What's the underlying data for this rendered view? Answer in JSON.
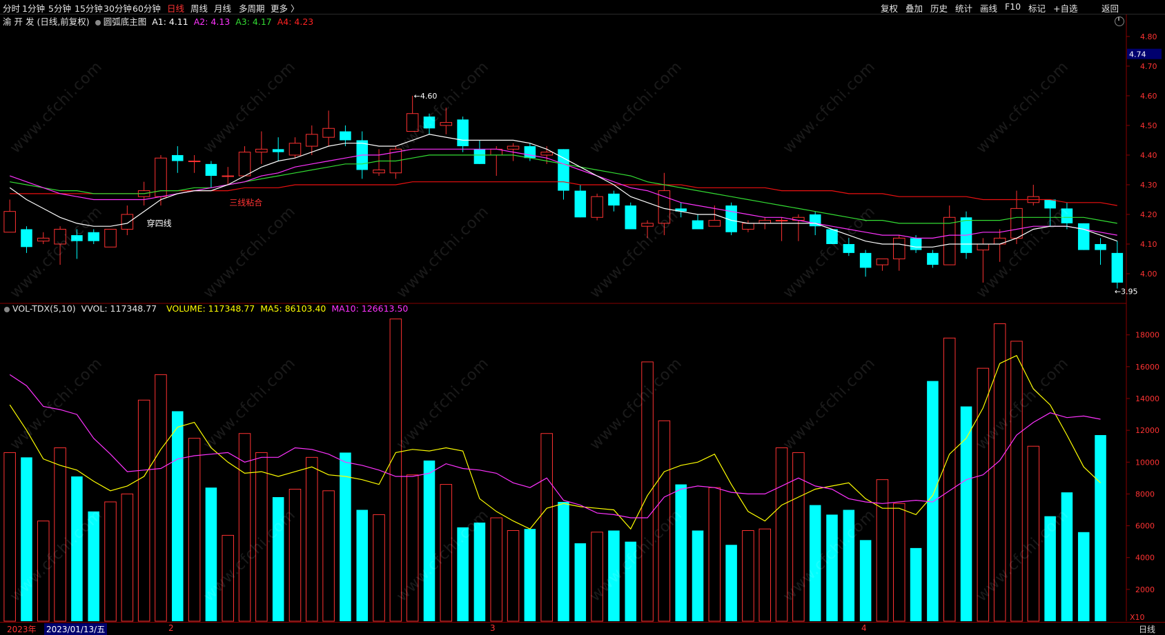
{
  "toolbar": {
    "periods": [
      {
        "label": "分时",
        "active": false
      },
      {
        "label": "1分钟",
        "active": false
      },
      {
        "label": "5分钟",
        "active": false
      },
      {
        "label": "15分钟",
        "active": false
      },
      {
        "label": "30分钟",
        "active": false
      },
      {
        "label": "60分钟",
        "active": false
      },
      {
        "label": "日线",
        "active": true
      },
      {
        "label": "周线",
        "active": false
      },
      {
        "label": "月线",
        "active": false
      },
      {
        "label": "多周期",
        "active": false
      },
      {
        "label": "更多 〉",
        "active": false
      }
    ],
    "right_buttons": [
      "复权",
      "叠加",
      "历史",
      "统计",
      "画线",
      "F10",
      "标记",
      "+自选",
      "返回"
    ]
  },
  "main_header": {
    "stock": "渝 开 发",
    "mode": "(日线,前复权)",
    "indicator": "圆弧底主图",
    "a1": "A1: 4.11",
    "a2": "A2: 4.13",
    "a3": "A3: 4.17",
    "a4": "A4: 4.23",
    "a1_color": "#ffffff",
    "a2_color": "#ff33ff",
    "a3_color": "#33dd33",
    "a4_color": "#ff2222"
  },
  "vol_header": {
    "name": "VOL-TDX(5,10)",
    "vvol": "VVOL: 117348.77",
    "volume": "VOLUME: 117348.77",
    "ma5": "MA5: 86103.40",
    "ma10": "MA10: 126613.50",
    "volume_color": "#ffff00",
    "ma10_color": "#ff33ff"
  },
  "price_axis": {
    "ticks": [
      "4.80",
      "4.70",
      "4.60",
      "4.50",
      "4.40",
      "4.30",
      "4.20",
      "4.10",
      "4.00"
    ],
    "current_price": "4.74"
  },
  "volume_axis": {
    "ticks": [
      "18000",
      "16000",
      "14000",
      "12000",
      "10000",
      "8000",
      "6000",
      "4000",
      "2000"
    ],
    "multiplier": "X10"
  },
  "annotations": {
    "high": "4.60",
    "low": "3.95",
    "label1": "穿四线",
    "label2": "三线粘合"
  },
  "bottom_bar": {
    "year": "2023年",
    "date": "2023/01/13/五",
    "month_labels": [
      "2",
      "3",
      "4"
    ],
    "period": "日线"
  },
  "watermark": "www.cfchi.com",
  "colors": {
    "up": "#ff3232",
    "down": "#00ffff",
    "line_white": "#ffffff",
    "line_magenta": "#ff33ff",
    "line_green": "#33dd33",
    "line_red": "#ee1111",
    "vol_ma5": "#ffff00",
    "vol_ma10": "#ff33ff",
    "axis": "#8a0000"
  },
  "chart_data": {
    "type": "candlestick",
    "candles": [
      {
        "o": 4.14,
        "h": 4.25,
        "l": 4.14,
        "c": 4.21
      },
      {
        "o": 4.15,
        "h": 4.16,
        "l": 4.07,
        "c": 4.09
      },
      {
        "o": 4.11,
        "h": 4.14,
        "l": 4.1,
        "c": 4.12
      },
      {
        "o": 4.1,
        "h": 4.16,
        "l": 4.03,
        "c": 4.15
      },
      {
        "o": 4.13,
        "h": 4.15,
        "l": 4.05,
        "c": 4.11
      },
      {
        "o": 4.14,
        "h": 4.15,
        "l": 4.1,
        "c": 4.11
      },
      {
        "o": 4.09,
        "h": 4.15,
        "l": 4.09,
        "c": 4.15
      },
      {
        "o": 4.15,
        "h": 4.23,
        "l": 4.13,
        "c": 4.2
      },
      {
        "o": 4.26,
        "h": 4.31,
        "l": 4.23,
        "c": 4.28
      },
      {
        "o": 4.26,
        "h": 4.4,
        "l": 4.23,
        "c": 4.39
      },
      {
        "o": 4.4,
        "h": 4.43,
        "l": 4.34,
        "c": 4.38
      },
      {
        "o": 4.38,
        "h": 4.4,
        "l": 4.34,
        "c": 4.38
      },
      {
        "o": 4.37,
        "h": 4.38,
        "l": 4.29,
        "c": 4.33
      },
      {
        "o": 4.33,
        "h": 4.36,
        "l": 4.3,
        "c": 4.33
      },
      {
        "o": 4.33,
        "h": 4.43,
        "l": 4.33,
        "c": 4.41
      },
      {
        "o": 4.41,
        "h": 4.48,
        "l": 4.37,
        "c": 4.42
      },
      {
        "o": 4.42,
        "h": 4.46,
        "l": 4.38,
        "c": 4.41
      },
      {
        "o": 4.4,
        "h": 4.46,
        "l": 4.39,
        "c": 4.44
      },
      {
        "o": 4.43,
        "h": 4.5,
        "l": 4.4,
        "c": 4.47
      },
      {
        "o": 4.46,
        "h": 4.55,
        "l": 4.43,
        "c": 4.49
      },
      {
        "o": 4.48,
        "h": 4.5,
        "l": 4.43,
        "c": 4.45
      },
      {
        "o": 4.45,
        "h": 4.48,
        "l": 4.32,
        "c": 4.35
      },
      {
        "o": 4.34,
        "h": 4.42,
        "l": 4.33,
        "c": 4.35
      },
      {
        "o": 4.34,
        "h": 4.43,
        "l": 4.32,
        "c": 4.42
      },
      {
        "o": 4.48,
        "h": 4.6,
        "l": 4.48,
        "c": 4.54
      },
      {
        "o": 4.53,
        "h": 4.54,
        "l": 4.47,
        "c": 4.49
      },
      {
        "o": 4.5,
        "h": 4.56,
        "l": 4.47,
        "c": 4.51
      },
      {
        "o": 4.52,
        "h": 4.53,
        "l": 4.41,
        "c": 4.43
      },
      {
        "o": 4.42,
        "h": 4.45,
        "l": 4.37,
        "c": 4.37
      },
      {
        "o": 4.4,
        "h": 4.43,
        "l": 4.33,
        "c": 4.42
      },
      {
        "o": 4.42,
        "h": 4.44,
        "l": 4.38,
        "c": 4.43
      },
      {
        "o": 4.43,
        "h": 4.44,
        "l": 4.38,
        "c": 4.39
      },
      {
        "o": 4.4,
        "h": 4.43,
        "l": 4.37,
        "c": 4.41
      },
      {
        "o": 4.42,
        "h": 4.42,
        "l": 4.25,
        "c": 4.28
      },
      {
        "o": 4.28,
        "h": 4.3,
        "l": 4.19,
        "c": 4.19
      },
      {
        "o": 4.19,
        "h": 4.27,
        "l": 4.18,
        "c": 4.26
      },
      {
        "o": 4.27,
        "h": 4.28,
        "l": 4.21,
        "c": 4.23
      },
      {
        "o": 4.23,
        "h": 4.24,
        "l": 4.15,
        "c": 4.15
      },
      {
        "o": 4.16,
        "h": 4.18,
        "l": 4.12,
        "c": 4.17
      },
      {
        "o": 4.17,
        "h": 4.34,
        "l": 4.13,
        "c": 4.28
      },
      {
        "o": 4.22,
        "h": 4.24,
        "l": 4.19,
        "c": 4.21
      },
      {
        "o": 4.18,
        "h": 4.2,
        "l": 4.15,
        "c": 4.15
      },
      {
        "o": 4.16,
        "h": 4.23,
        "l": 4.16,
        "c": 4.18
      },
      {
        "o": 4.23,
        "h": 4.24,
        "l": 4.13,
        "c": 4.14
      },
      {
        "o": 4.15,
        "h": 4.18,
        "l": 4.14,
        "c": 4.17
      },
      {
        "o": 4.17,
        "h": 4.19,
        "l": 4.15,
        "c": 4.18
      },
      {
        "o": 4.18,
        "h": 4.19,
        "l": 4.11,
        "c": 4.18
      },
      {
        "o": 4.18,
        "h": 4.2,
        "l": 4.11,
        "c": 4.19
      },
      {
        "o": 4.2,
        "h": 4.21,
        "l": 4.13,
        "c": 4.16
      },
      {
        "o": 4.15,
        "h": 4.15,
        "l": 4.1,
        "c": 4.1
      },
      {
        "o": 4.1,
        "h": 4.12,
        "l": 4.06,
        "c": 4.07
      },
      {
        "o": 4.07,
        "h": 4.08,
        "l": 3.99,
        "c": 4.02
      },
      {
        "o": 4.03,
        "h": 4.05,
        "l": 4.01,
        "c": 4.05
      },
      {
        "o": 4.05,
        "h": 4.13,
        "l": 4.01,
        "c": 4.12
      },
      {
        "o": 4.12,
        "h": 4.13,
        "l": 4.07,
        "c": 4.08
      },
      {
        "o": 4.07,
        "h": 4.08,
        "l": 4.02,
        "c": 4.03
      },
      {
        "o": 4.03,
        "h": 4.23,
        "l": 4.03,
        "c": 4.19
      },
      {
        "o": 4.19,
        "h": 4.21,
        "l": 4.05,
        "c": 4.07
      },
      {
        "o": 4.08,
        "h": 4.12,
        "l": 3.97,
        "c": 4.1
      },
      {
        "o": 4.1,
        "h": 4.15,
        "l": 4.04,
        "c": 4.12
      },
      {
        "o": 4.12,
        "h": 4.28,
        "l": 4.1,
        "c": 4.22
      },
      {
        "o": 4.24,
        "h": 4.3,
        "l": 4.23,
        "c": 4.26
      },
      {
        "o": 4.25,
        "h": 4.25,
        "l": 4.16,
        "c": 4.22
      },
      {
        "o": 4.22,
        "h": 4.24,
        "l": 4.15,
        "c": 4.17
      },
      {
        "o": 4.17,
        "h": 4.17,
        "l": 4.08,
        "c": 4.08
      },
      {
        "o": 4.1,
        "h": 4.12,
        "l": 4.03,
        "c": 4.08
      },
      {
        "o": 4.07,
        "h": 4.11,
        "l": 3.95,
        "c": 3.97
      }
    ],
    "volumes": [
      10600,
      10300,
      6300,
      10900,
      9100,
      6900,
      7500,
      8000,
      13900,
      15500,
      13200,
      11500,
      8400,
      5400,
      11800,
      10600,
      7800,
      8300,
      10300,
      8200,
      10600,
      7000,
      6700,
      19000,
      9200,
      10100,
      8600,
      5900,
      6200,
      6500,
      5700,
      5800,
      11800,
      7500,
      4900,
      5600,
      5700,
      5000,
      16300,
      12600,
      8600,
      5700,
      8400,
      4800,
      5700,
      5800,
      10900,
      10600,
      7300,
      6700,
      7000,
      5100,
      8900,
      7400,
      4600,
      15100,
      17800,
      13500,
      15900,
      18700,
      17600,
      11000,
      6600,
      8100,
      5600,
      11700
    ],
    "ma_white": [
      4.29,
      4.25,
      4.22,
      4.19,
      4.17,
      4.16,
      4.16,
      4.17,
      4.21,
      4.25,
      4.27,
      4.28,
      4.28,
      4.3,
      4.33,
      4.36,
      4.38,
      4.39,
      4.41,
      4.43,
      4.44,
      4.44,
      4.43,
      4.43,
      4.45,
      4.47,
      4.46,
      4.45,
      4.45,
      4.45,
      4.45,
      4.44,
      4.42,
      4.39,
      4.36,
      4.33,
      4.3,
      4.26,
      4.24,
      4.22,
      4.21,
      4.2,
      4.2,
      4.18,
      4.17,
      4.17,
      4.17,
      4.17,
      4.17,
      4.15,
      4.13,
      4.11,
      4.1,
      4.1,
      4.09,
      4.09,
      4.1,
      4.1,
      4.1,
      4.1,
      4.12,
      4.15,
      4.16,
      4.16,
      4.15,
      4.13,
      4.11
    ],
    "ma_magenta": [
      4.33,
      4.31,
      4.29,
      4.27,
      4.26,
      4.25,
      4.25,
      4.25,
      4.25,
      4.26,
      4.27,
      4.28,
      4.29,
      4.3,
      4.31,
      4.33,
      4.34,
      4.36,
      4.37,
      4.38,
      4.39,
      4.4,
      4.4,
      4.41,
      4.42,
      4.42,
      4.42,
      4.42,
      4.42,
      4.42,
      4.41,
      4.4,
      4.39,
      4.37,
      4.35,
      4.33,
      4.31,
      4.29,
      4.28,
      4.26,
      4.24,
      4.23,
      4.22,
      4.21,
      4.2,
      4.19,
      4.19,
      4.18,
      4.17,
      4.16,
      4.15,
      4.14,
      4.13,
      4.13,
      4.12,
      4.12,
      4.13,
      4.13,
      4.14,
      4.14,
      4.15,
      4.16,
      4.16,
      4.16,
      4.15,
      4.14,
      4.13
    ],
    "ma_green": [
      4.31,
      4.3,
      4.29,
      4.28,
      4.28,
      4.27,
      4.27,
      4.27,
      4.27,
      4.28,
      4.28,
      4.29,
      4.29,
      4.3,
      4.31,
      4.32,
      4.33,
      4.34,
      4.35,
      4.36,
      4.37,
      4.37,
      4.38,
      4.38,
      4.39,
      4.4,
      4.4,
      4.4,
      4.4,
      4.4,
      4.4,
      4.39,
      4.38,
      4.37,
      4.36,
      4.35,
      4.34,
      4.33,
      4.31,
      4.3,
      4.29,
      4.28,
      4.27,
      4.26,
      4.25,
      4.24,
      4.23,
      4.22,
      4.21,
      4.2,
      4.19,
      4.18,
      4.18,
      4.17,
      4.17,
      4.17,
      4.17,
      4.18,
      4.18,
      4.18,
      4.19,
      4.19,
      4.19,
      4.19,
      4.19,
      4.18,
      4.17
    ],
    "ma_red": [
      4.27,
      4.27,
      4.27,
      4.27,
      4.27,
      4.27,
      4.27,
      4.27,
      4.27,
      4.28,
      4.28,
      4.28,
      4.28,
      4.28,
      4.29,
      4.29,
      4.29,
      4.3,
      4.3,
      4.3,
      4.3,
      4.3,
      4.3,
      4.3,
      4.31,
      4.31,
      4.31,
      4.31,
      4.31,
      4.31,
      4.31,
      4.31,
      4.31,
      4.31,
      4.3,
      4.3,
      4.3,
      4.3,
      4.3,
      4.3,
      4.3,
      4.29,
      4.29,
      4.29,
      4.29,
      4.29,
      4.28,
      4.28,
      4.28,
      4.28,
      4.27,
      4.27,
      4.27,
      4.26,
      4.26,
      4.26,
      4.26,
      4.26,
      4.25,
      4.25,
      4.25,
      4.25,
      4.25,
      4.24,
      4.24,
      4.24,
      4.23
    ],
    "vol_ma5": [
      13600,
      12000,
      10200,
      9800,
      9500,
      8800,
      8200,
      8500,
      9100,
      10800,
      12200,
      12500,
      10900,
      10000,
      9300,
      9400,
      9100,
      9400,
      9700,
      9200,
      9100,
      8900,
      8600,
      10600,
      10800,
      10700,
      10900,
      10700,
      7700,
      6900,
      6300,
      5800,
      7100,
      7400,
      7200,
      7100,
      7000,
      5800,
      7900,
      9400,
      9800,
      10000,
      10500,
      8600,
      6900,
      6300,
      7300,
      7800,
      8300,
      8500,
      8700,
      7700,
      7100,
      7100,
      6700,
      7900,
      10500,
      11500,
      13400,
      16200,
      16700,
      14600,
      13600,
      11700,
      9700,
      8700
    ],
    "vol_ma10": [
      15500,
      14800,
      13500,
      13300,
      13000,
      11500,
      10500,
      9400,
      9500,
      9600,
      10200,
      10400,
      10500,
      10600,
      10000,
      10300,
      10300,
      10900,
      10800,
      10500,
      10000,
      9800,
      9500,
      9100,
      9100,
      9300,
      9900,
      9600,
      9500,
      9300,
      8700,
      8400,
      9000,
      7600,
      7300,
      6800,
      6700,
      6500,
      6500,
      7800,
      8300,
      8500,
      8400,
      8100,
      8000,
      8000,
      8500,
      9000,
      8500,
      8300,
      7700,
      7500,
      7400,
      7500,
      7600,
      7500,
      8200,
      8900,
      9200,
      10100,
      11700,
      12500,
      13100,
      12800,
      12900,
      12700
    ],
    "price_range": [
      3.9,
      4.83
    ],
    "volume_range": [
      0,
      19200
    ]
  }
}
